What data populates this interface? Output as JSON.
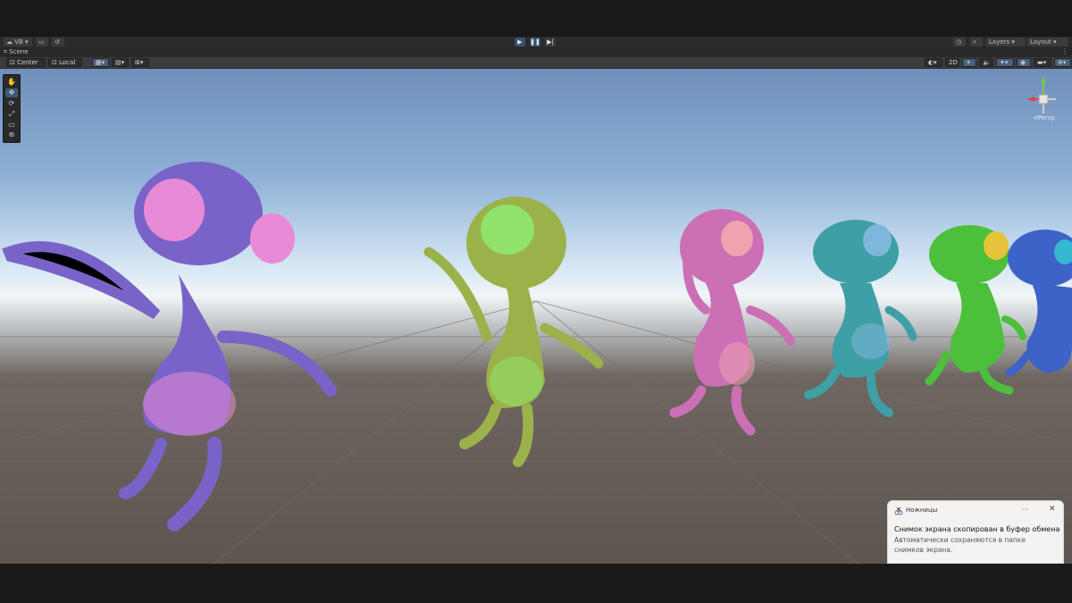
{
  "main_toolbar": {
    "account_label": "VB",
    "layers_label": "Layers",
    "layout_label": "Layout",
    "play_icons": [
      "play-icon",
      "pause-icon",
      "step-icon"
    ]
  },
  "scene_tab": {
    "label": "Scene"
  },
  "scene_toolbar": {
    "pivot_label": "Center",
    "space_label": "Local",
    "mode_2d_label": "2D"
  },
  "tools": [
    "hand-tool-icon",
    "move-tool-icon",
    "rotate-tool-icon",
    "scale-tool-icon",
    "rect-tool-icon",
    "transform-tool-icon"
  ],
  "gizmo": {
    "projection_label": "Persp"
  },
  "viewport": {
    "creatures": [
      {
        "color": "#7a63c8",
        "accent": "#e98ad6"
      },
      {
        "color": "#9bb24a",
        "accent": "#8fe36b"
      },
      {
        "color": "#cc6fb5",
        "accent": "#f1a2b0"
      },
      {
        "color": "#3f9fa6",
        "accent": "#7db7d9"
      },
      {
        "color": "#4cc03a",
        "accent": "#e8c23a"
      },
      {
        "color": "#3d63c9",
        "accent": "#33b8d0"
      }
    ]
  },
  "toast": {
    "app_name": "Ножницы",
    "title": "Снимок экрана скопирован в буфер обмена",
    "body": "Автоматически сохраняются в папке снимков экрана.",
    "more_label": "···",
    "close_label": "✕"
  }
}
